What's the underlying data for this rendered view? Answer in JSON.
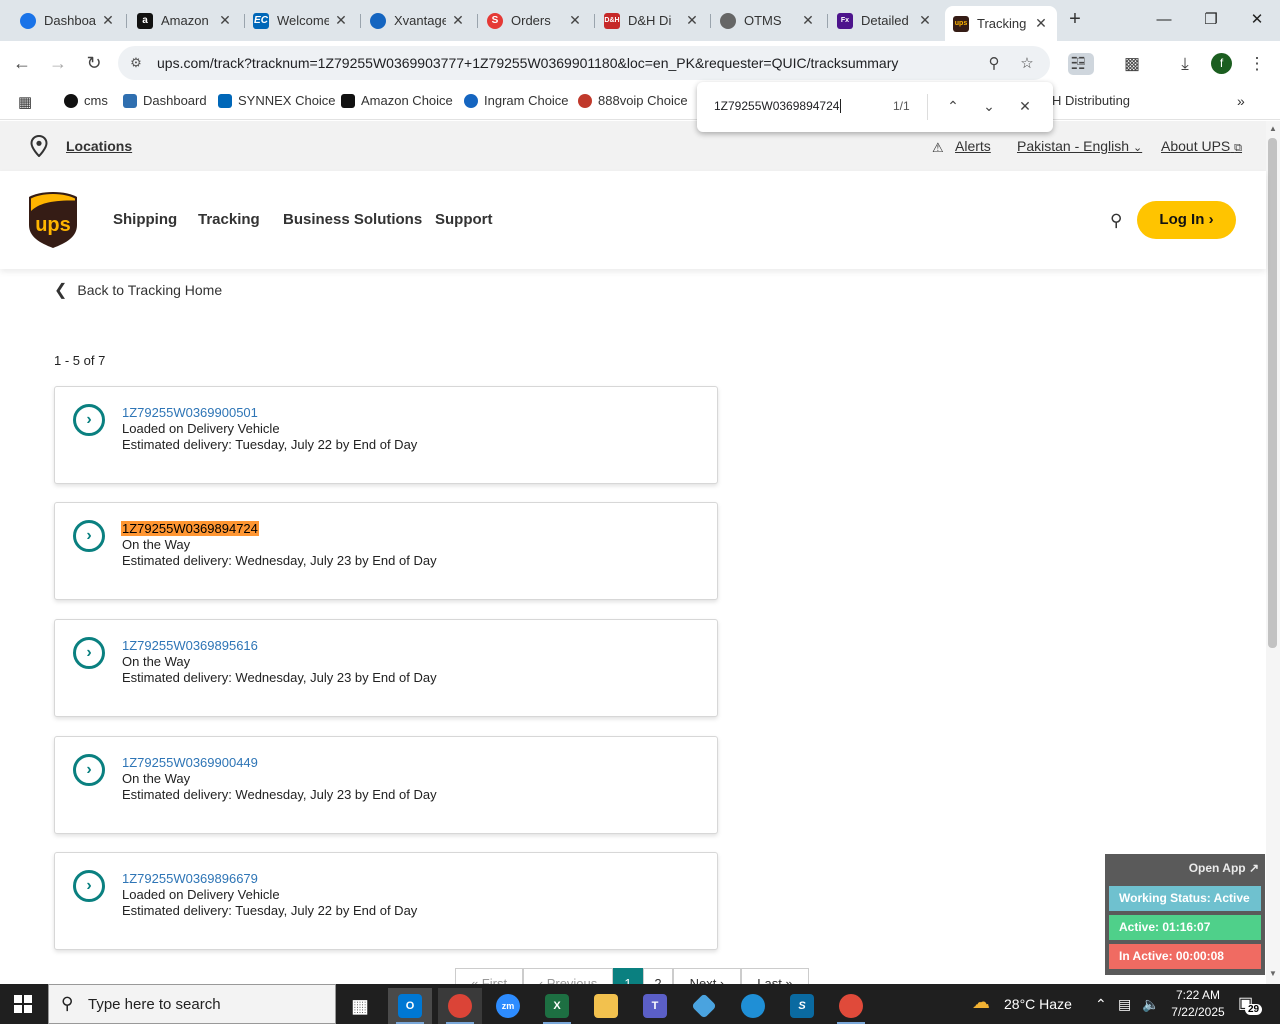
{
  "browser": {
    "tabs": [
      {
        "label": "Dashboard",
        "favicon_color": "#1a73e8",
        "active": false
      },
      {
        "label": "Amazon",
        "favicon_color": "#111111",
        "active": false
      },
      {
        "label": "Welcome",
        "favicon_color": "#0067b8",
        "active": false
      },
      {
        "label": "Xvantage",
        "favicon_color": "#1565c0",
        "active": false
      },
      {
        "label": "Orders",
        "favicon_color": "#e53935",
        "active": false
      },
      {
        "label": "D&H Di",
        "favicon_color": "#c62828",
        "active": false
      },
      {
        "label": "OTMS",
        "favicon_color": "#666666",
        "active": false
      },
      {
        "label": "Detailed",
        "favicon_color": "#4d148c",
        "active": false
      },
      {
        "label": "Tracking",
        "favicon_color": "#351c15",
        "active": true
      }
    ],
    "url": "ups.com/track?tracknum=1Z79255W0369903777+1Z79255W0369901180&loc=en_PK&requester=QUIC/tracksummary",
    "profile_initial": "f",
    "bookmarks": [
      {
        "label": "cms",
        "color": "#111111"
      },
      {
        "label": "Dashboard",
        "color": "#2f6fb0"
      },
      {
        "label": "SYNNEX Choice",
        "color": "#0067b8"
      },
      {
        "label": "Amazon Choice",
        "color": "#111111"
      },
      {
        "label": "Ingram Choice",
        "color": "#1565c0"
      },
      {
        "label": "888voip Choice",
        "color": "#c0392b"
      },
      {
        "label": "H Distributing",
        "color": "#c62828"
      }
    ],
    "find": {
      "query": "1Z79255W0369894724",
      "count": "1/1"
    }
  },
  "ups": {
    "utility": {
      "locations": "Locations",
      "alerts": "Alerts",
      "language": "Pakistan - English",
      "about": "About UPS"
    },
    "logo_text": "ups",
    "nav": [
      "Shipping",
      "Tracking",
      "Business Solutions",
      "Support"
    ],
    "login": "Log In",
    "back_link": "Back to Tracking Home",
    "range": "1 - 5 of 7",
    "shipments": [
      {
        "number": "1Z79255W0369900501",
        "status": "Loaded on Delivery Vehicle",
        "estimate": "Estimated delivery: Tuesday, July 22 by End of Day",
        "highlighted": false
      },
      {
        "number": "1Z79255W0369894724",
        "status": "On the Way",
        "estimate": "Estimated delivery: Wednesday, July 23 by End of Day",
        "highlighted": true
      },
      {
        "number": "1Z79255W0369895616",
        "status": "On the Way",
        "estimate": "Estimated delivery: Wednesday, July 23 by End of Day",
        "highlighted": false
      },
      {
        "number": "1Z79255W0369900449",
        "status": "On the Way",
        "estimate": "Estimated delivery: Wednesday, July 23 by End of Day",
        "highlighted": false
      },
      {
        "number": "1Z79255W0369896679",
        "status": "Loaded on Delivery Vehicle",
        "estimate": "Estimated delivery: Tuesday, July 22 by End of Day",
        "highlighted": false
      }
    ],
    "pagination": {
      "first": "First",
      "previous": "Previous",
      "pages": [
        "1",
        "2"
      ],
      "current": "1",
      "next": "Next",
      "last": "Last"
    }
  },
  "widget": {
    "open_app": "Open App",
    "working_status": "Working Status: Active",
    "active": "Active: 01:16:07",
    "inactive": "In Active: 00:00:08",
    "colors": {
      "status": "#6fc1cf",
      "active": "#4fd08a",
      "inactive": "#f06b62"
    }
  },
  "taskbar": {
    "search_placeholder": "Type here to search",
    "weather": "28°C  Haze",
    "time": "7:22 AM",
    "date": "7/22/2025",
    "notifications": "29"
  }
}
